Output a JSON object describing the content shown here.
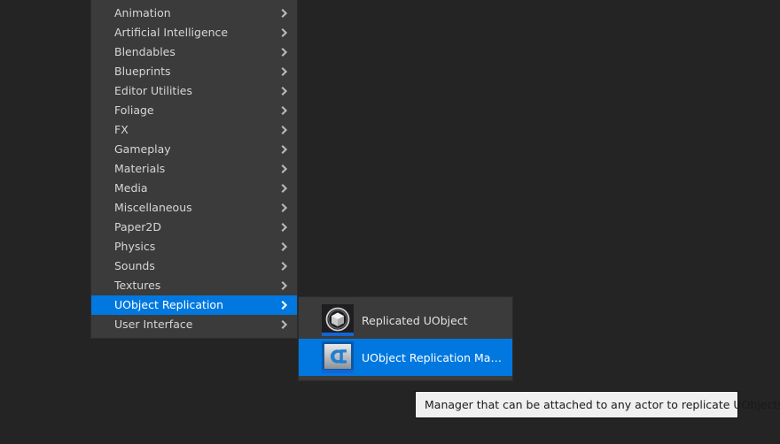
{
  "colors": {
    "background": "#242424",
    "menu_bg": "#3b3b3b",
    "menu_border": "#2c2c2c",
    "highlight": "#0078e0",
    "text": "#d6d6d6",
    "text_selected": "#ffffff",
    "tooltip_bg": "#f0f0f0",
    "tooltip_text": "#1a1a1a",
    "icon_underline": "#1464d2"
  },
  "menu": {
    "name": "asset-category-menu",
    "items": [
      {
        "label": "Animation",
        "has_submenu": true,
        "selected": false
      },
      {
        "label": "Artificial Intelligence",
        "has_submenu": true,
        "selected": false
      },
      {
        "label": "Blendables",
        "has_submenu": true,
        "selected": false
      },
      {
        "label": "Blueprints",
        "has_submenu": true,
        "selected": false
      },
      {
        "label": "Editor Utilities",
        "has_submenu": true,
        "selected": false
      },
      {
        "label": "Foliage",
        "has_submenu": true,
        "selected": false
      },
      {
        "label": "FX",
        "has_submenu": true,
        "selected": false
      },
      {
        "label": "Gameplay",
        "has_submenu": true,
        "selected": false
      },
      {
        "label": "Materials",
        "has_submenu": true,
        "selected": false
      },
      {
        "label": "Media",
        "has_submenu": true,
        "selected": false
      },
      {
        "label": "Miscellaneous",
        "has_submenu": true,
        "selected": false
      },
      {
        "label": "Paper2D",
        "has_submenu": true,
        "selected": false
      },
      {
        "label": "Physics",
        "has_submenu": true,
        "selected": false
      },
      {
        "label": "Sounds",
        "has_submenu": true,
        "selected": false
      },
      {
        "label": "Textures",
        "has_submenu": true,
        "selected": false
      },
      {
        "label": "UObject Replication",
        "has_submenu": true,
        "selected": true
      },
      {
        "label": "User Interface",
        "has_submenu": true,
        "selected": false
      }
    ]
  },
  "submenu": {
    "name": "uobject-replication-submenu",
    "items": [
      {
        "label": "Replicated UObject",
        "icon": "cube-in-circle-icon",
        "selected": false
      },
      {
        "label": "UObject Replication Manager",
        "icon": "blueprint-class-icon",
        "selected": true
      }
    ]
  },
  "tooltip": {
    "text": "Manager that can be attached to any actor to replicate UObjects."
  }
}
